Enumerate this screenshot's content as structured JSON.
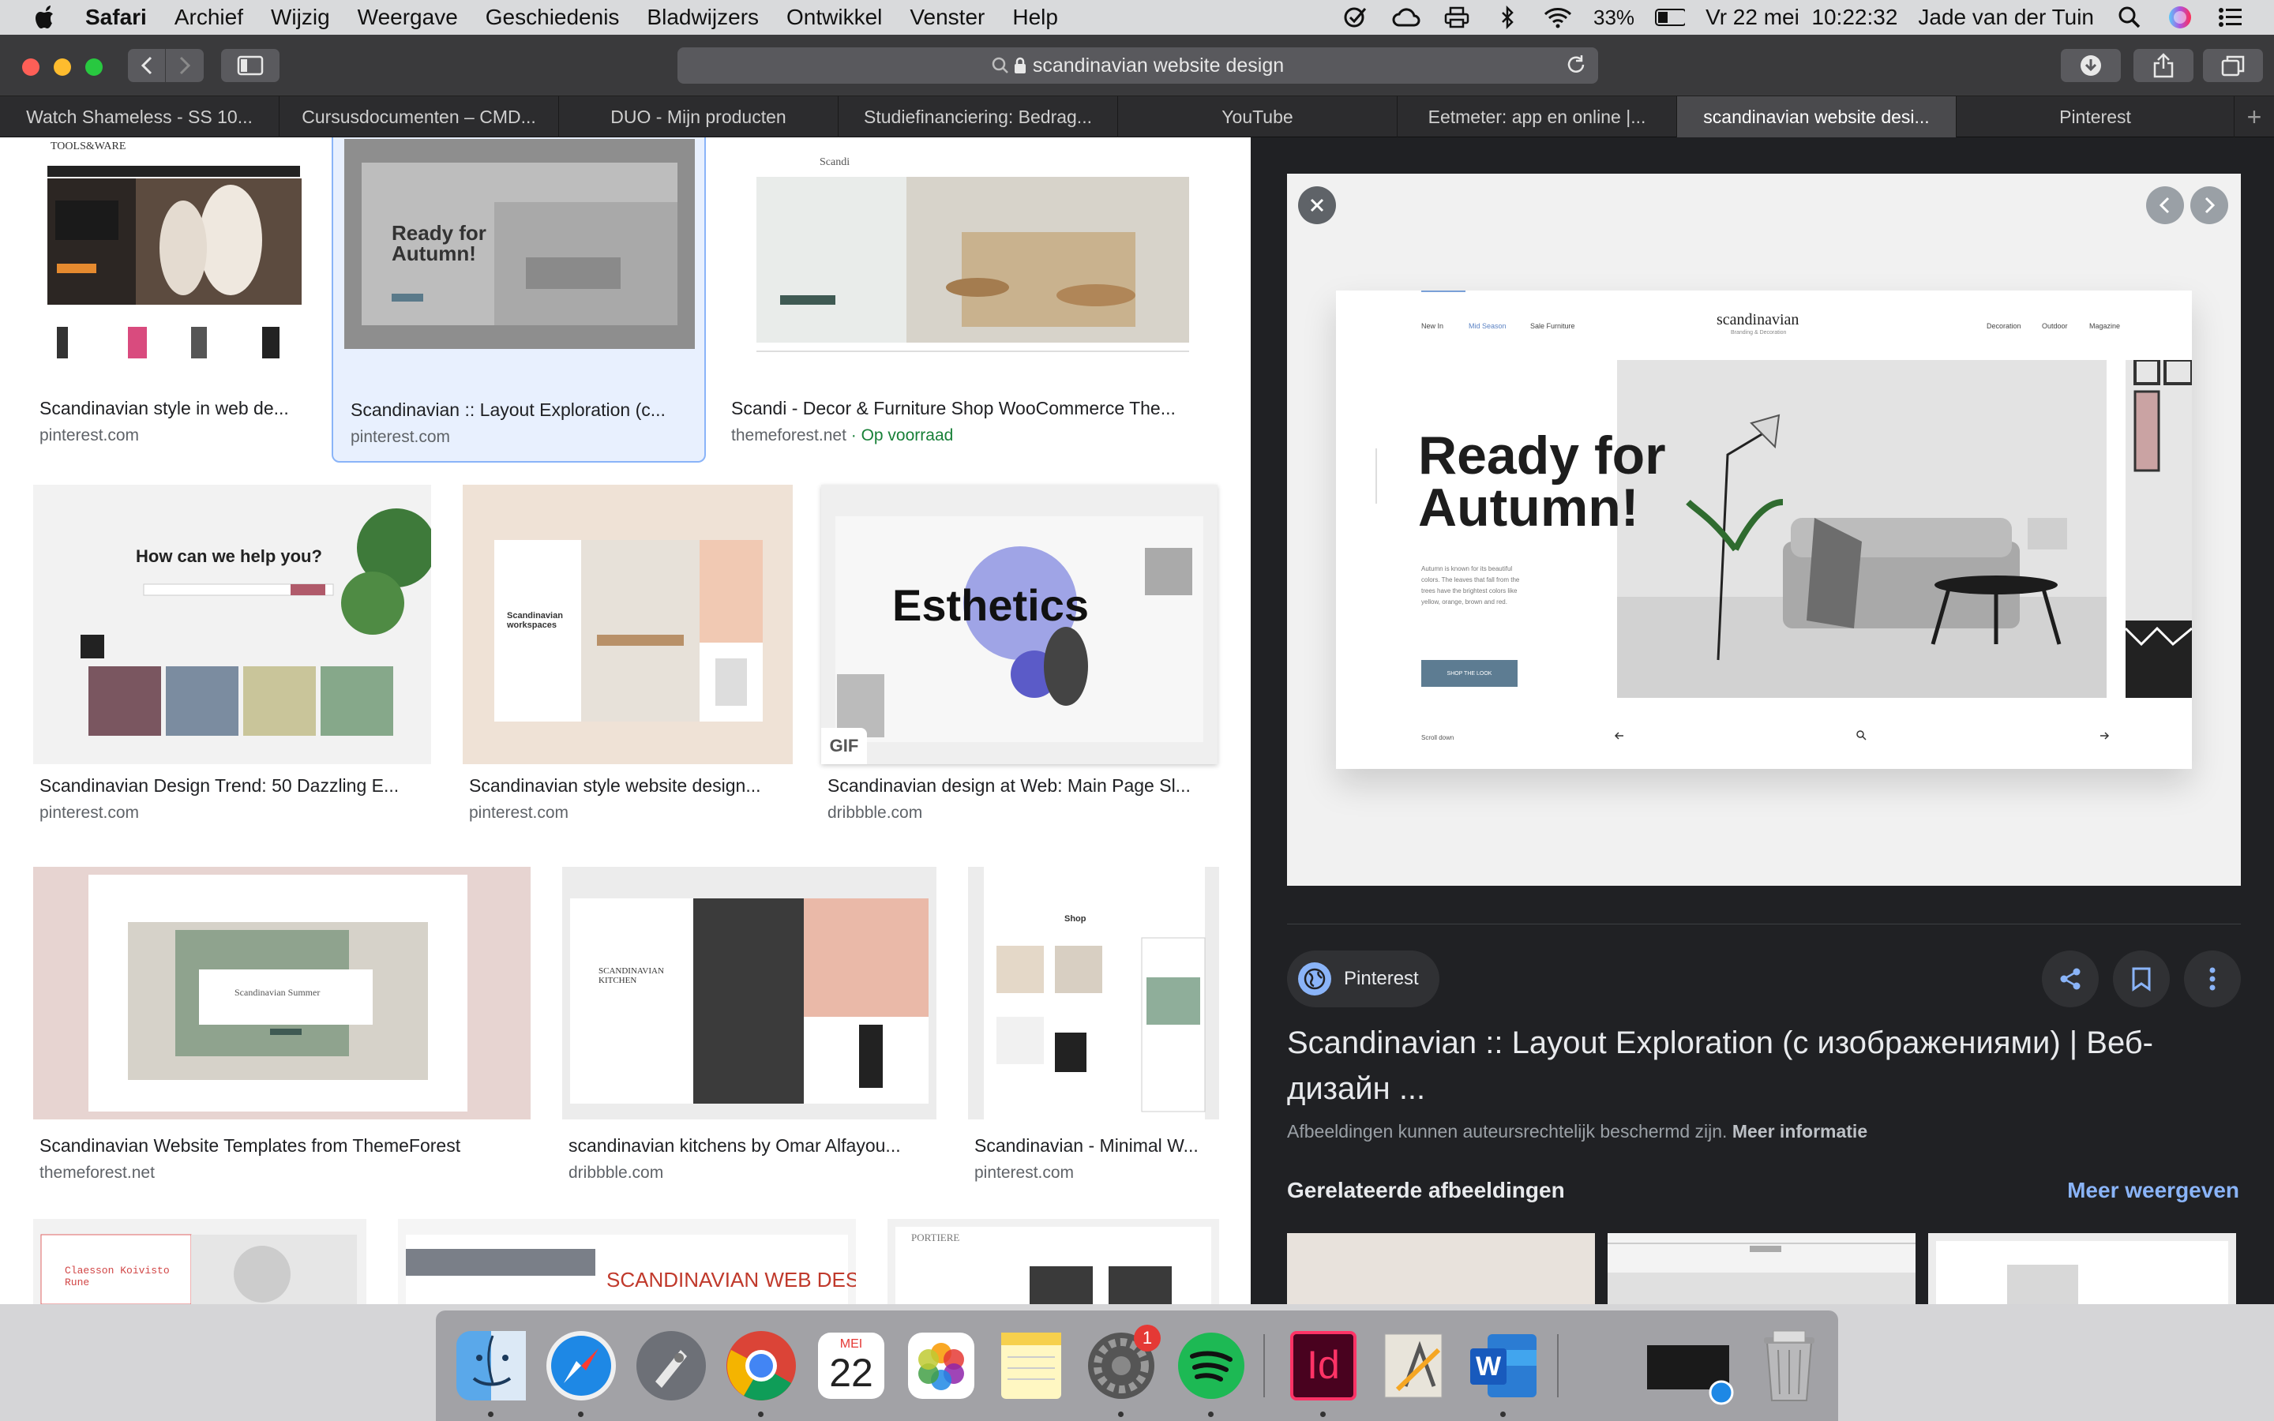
{
  "menubar": {
    "app": "Safari",
    "items": [
      "Archief",
      "Wijzig",
      "Weergave",
      "Geschiedenis",
      "Bladwijzers",
      "Ontwikkel",
      "Venster",
      "Help"
    ],
    "battery": "33%",
    "datetime": "Vr 22 mei  10:22:32",
    "user": "Jade van der Tuin"
  },
  "toolbar": {
    "address": "scandinavian website design"
  },
  "tabs": [
    "Watch Shameless - SS 10...",
    "Cursusdocumenten – CMD...",
    "DUO - Mijn producten",
    "Studiefinanciering: Bedrag...",
    "YouTube",
    "Eetmeter: app en online |...",
    "scandinavian website desi...",
    "Pinterest"
  ],
  "results": {
    "row1": [
      {
        "title": "Scandinavian style in web de...",
        "source": "pinterest.com",
        "thumb_text": "TOOLS&WARE"
      },
      {
        "title": "Scandinavian :: Layout Exploration (c...",
        "source": "pinterest.com",
        "thumb_text": "Ready for Autumn!"
      },
      {
        "title": "Scandi - Decor & Furniture Shop WooCommerce The...",
        "source": "themeforest.net",
        "source_extra": " · Op voorraad",
        "thumb_text": "Scandi"
      }
    ],
    "row2": [
      {
        "title": "Scandinavian Design Trend: 50 Dazzling E...",
        "source": "pinterest.com",
        "thumb_text": "How can we help you?"
      },
      {
        "title": "Scandinavian style website design...",
        "source": "pinterest.com",
        "thumb_text": "Scandinavian workspaces"
      },
      {
        "title": "Scandinavian design at Web: Main Page Sl...",
        "source": "dribbble.com",
        "thumb_text": "Esthetics",
        "badge": "GIF"
      }
    ],
    "row3": [
      {
        "title": "Scandinavian Website Templates from ThemeForest",
        "source": "themeforest.net",
        "thumb_text": "Scandinavian Summer"
      },
      {
        "title": "scandinavian kitchens by Omar Alfayou...",
        "source": "dribbble.com",
        "thumb_text": "SCANDINAVIAN KITCHEN"
      },
      {
        "title": "Scandinavian - Minimal W...",
        "source": "pinterest.com",
        "thumb_text": "Shop"
      }
    ],
    "row4": [
      {
        "thumb_text": "Claesson Koivisto Rune"
      },
      {
        "thumb_text": "SCANDINAVIAN WEB DES"
      },
      {
        "thumb_text": "PORTIERE"
      }
    ]
  },
  "panel": {
    "preview": {
      "brand": "scandinavian",
      "brand_sub": "Branding & Decoration",
      "nav_left": [
        "New In",
        "Mid Season",
        "Sale Furniture"
      ],
      "nav_right": [
        "Decoration",
        "Outdoor",
        "Magazine"
      ],
      "headline": "Ready for Autumn!",
      "body": "Autumn is known for its beautiful colors. The leaves that fall from the trees have the brightest colors like yellow, orange, brown and red.",
      "cta": "SHOP THE LOOK",
      "scroll": "Scroll down"
    },
    "source_label": "Pinterest",
    "title": "Scandinavian :: Layout Exploration (с изображениями) | Веб-дизайн ...",
    "note_text": "Afbeeldingen kunnen auteursrechtelijk beschermd zijn.",
    "note_link": "Meer informatie",
    "related_heading": "Gerelateerde afbeeldingen",
    "related_more": "Meer weergeven"
  },
  "dock": {
    "calendar_month": "MEI",
    "calendar_day": "22",
    "badge": "1",
    "indesign": "Id",
    "word": "W"
  }
}
